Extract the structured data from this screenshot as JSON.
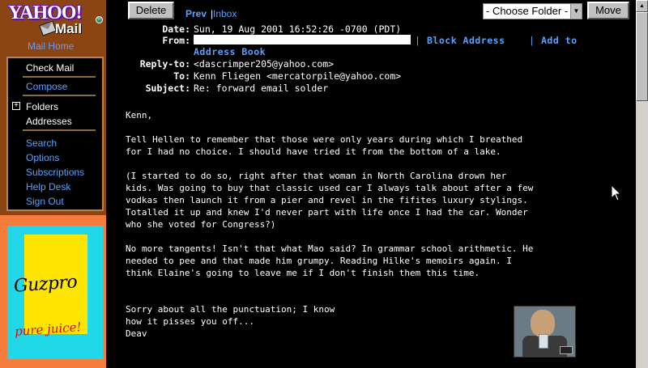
{
  "sidebar": {
    "logo_yahoo": "YAHOO!",
    "logo_mail": "Mail",
    "mail_home": "Mail Home",
    "nav": {
      "check_mail": "Check Mail",
      "compose": "Compose",
      "folders": "Folders",
      "addresses": "Addresses",
      "search": "Search",
      "options": "Options",
      "subscriptions": "Subscriptions",
      "help_desk": "Help Desk",
      "sign_out": "Sign Out"
    },
    "ad": {
      "brand": "Guzpro",
      "tagline": "pure juice!"
    }
  },
  "toolbar": {
    "delete_label": "Delete",
    "prev_label": "Prev",
    "separator": "|",
    "inbox_label": "Inbox",
    "folder_select_value": "- Choose Folder -",
    "move_label": "Move"
  },
  "email": {
    "headers": {
      "date_label": "Date:",
      "date_value": "Sun, 19 Aug 2001 16:52:26 -0700 (PDT)",
      "from_label": "From:",
      "from_value": "",
      "block_address": "Block Address",
      "add_to": "Add to",
      "address_book": "Address Book",
      "link_sep_1": "|",
      "link_sep_2": "|",
      "reply_to_label": "Reply-to:",
      "reply_to_value": "<dascrimper205@yahoo.com>",
      "to_label": "To:",
      "to_value": "Kenn Fliegen <mercatorpile@yahoo.com>",
      "subject_label": "Subject:",
      "subject_value": "Re: forward email solder"
    },
    "body": "Kenn,\n\nTell Hellen to remember that those were only years during which I breathed\nfor I had no choice. I should have tried it from the bottom of a lake.\n\n(I started to do so, right after that woman in North Carolina drown her\nkids. Was going to buy that classic used car I always talk about after a few\nvodkas then launch it from a pier and revel in the fifites luxury stylings.\nTotalled it up and knew I'd never part with life once I had the car. Wonder\nwho she voted for Congress?)\n\nNo more tangents! Isn't that what Mao said? In grammar school arithmetic. He\nneeded to pee and that made him grumpy. Reading Hilke's memoirs again. I\nthink Elaine's going to leave me if I don't finish them this time.\n\n\nSorry about all the punctuation; I know\nhow it pisses you off...\nDeav"
  },
  "colors": {
    "sidebar_bg": "#8b4513",
    "link": "#5aa0ff",
    "ad_orange": "#f47c3c",
    "ad_cyan": "#20d8e8",
    "ad_yellow": "#ffe600"
  }
}
